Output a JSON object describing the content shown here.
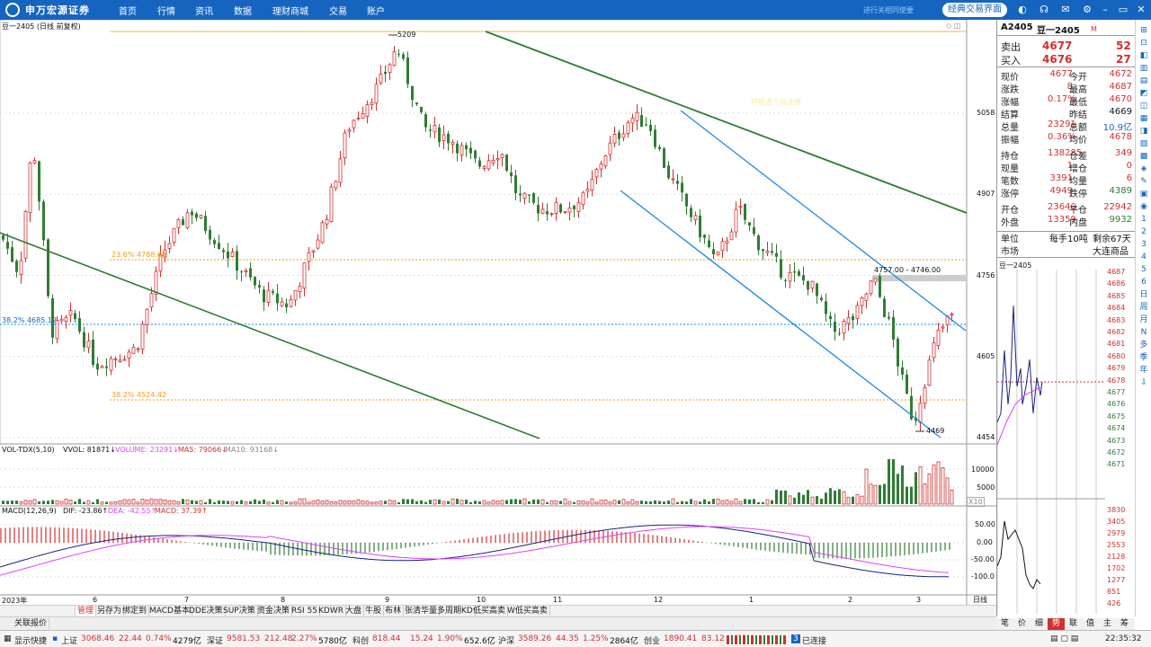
{
  "app": {
    "logo_text": "申万宏源证券",
    "nav": [
      "首页",
      "行情",
      "资讯",
      "数据",
      "理财商城",
      "交易",
      "账户"
    ],
    "faint_text": "进行关相同使要",
    "classic_btn": "经典交易界面"
  },
  "chart": {
    "symbol_title": "豆一2405 (日线 前复权)",
    "price_axis": [
      "5058",
      "4907",
      "4756",
      "4605",
      "4454"
    ],
    "fib_labels": [
      "23.6% 4788.68",
      "38.2% 4685.12",
      "38.2% 4524.42"
    ],
    "peak_label": "5209",
    "low_label": "4469",
    "range_label": "4757.00 - 4746.00",
    "faint_note": "可框选个段选择",
    "vol_header": {
      "name": "VOL-TDX(5,10)",
      "vvol": "VVOL: 81871↓",
      "volume": "VOLUME: 23291↓",
      "ma5": "MA5: 79066↓",
      "ma10": "MA10: 93168↓"
    },
    "vol_axis": [
      "10000",
      "5000",
      "X10"
    ],
    "macd_header": {
      "name": "MACD(12,26,9)",
      "dif": "DIF: -23.86↑",
      "dea": "DEA: -42.55↑",
      "macd": "MACD: 37.39↑"
    },
    "macd_axis": [
      "50.00",
      "0.00",
      "-50.00",
      "-100.0"
    ],
    "date_axis": [
      "2023年",
      "6",
      "7",
      "8",
      "9",
      "10",
      "11",
      "12",
      "1",
      "2",
      "3"
    ],
    "period_label": "日线",
    "zoom_minus": "−",
    "zoom_plus": "+"
  },
  "tabs": [
    "管理",
    "另存为",
    "绑定到",
    "MACD基本",
    "DDE决策",
    "SUP决策",
    "资金决策",
    "RSI 55",
    "KDWR",
    "大盘",
    "牛股",
    "布林",
    "张清华量",
    "多周期KD",
    "低买高卖",
    "W低买高卖"
  ],
  "quick_tab": "关联报价",
  "quote": {
    "code": "A2405",
    "name": "豆一2405",
    "flag": "M",
    "sell": {
      "label": "卖出",
      "price": "4677",
      "vol": "52"
    },
    "buy": {
      "label": "买入",
      "price": "4676",
      "vol": "27"
    },
    "rows": [
      [
        "现价",
        "4677",
        "今开",
        "4672"
      ],
      [
        "涨跌",
        "8",
        "最高",
        "4687"
      ],
      [
        "涨幅",
        "0.17%",
        "最低",
        "4670"
      ],
      [
        "结算",
        "",
        "昨结",
        "4669"
      ],
      [
        "总量",
        "23291",
        "总额",
        "10.9亿"
      ],
      [
        "振幅",
        "0.36%",
        "均价",
        "4678"
      ],
      [
        "持仓",
        "138285",
        "仓差",
        "349"
      ],
      [
        "现量",
        "1",
        "增仓",
        "0"
      ],
      [
        "笔数",
        "3391",
        "均量",
        "6"
      ],
      [
        "涨停",
        "4949",
        "跌停",
        "4389"
      ],
      [
        "开仓",
        "23640",
        "平仓",
        "22942"
      ],
      [
        "外盘",
        "13359",
        "内盘",
        "9932"
      ]
    ],
    "unit": {
      "label": "单位",
      "value": "每手10吨",
      "remain": "剩余67天"
    },
    "market": {
      "label": "市场",
      "value": "大连商品"
    },
    "mini_title": "豆一2405",
    "mini_prices": [
      "4687",
      "4686",
      "4685",
      "4684",
      "4683",
      "4682",
      "4681",
      "4680",
      "4679",
      "4678",
      "4677",
      "4676",
      "4675",
      "4674",
      "4673",
      "4672",
      "4671"
    ],
    "mini_vol": [
      "3830",
      "3405",
      "2979",
      "2553",
      "2128",
      "1702",
      "1277",
      "851",
      "426"
    ],
    "bottom_tabs": [
      "笔",
      "价",
      "细",
      "势",
      "联",
      "值",
      "主",
      "筹"
    ]
  },
  "status": {
    "quick": "显示快捷",
    "items": [
      {
        "name": "上证",
        "price": "3068.46",
        "chg": "22.44",
        "pct": "0.74%",
        "amt": "4279亿"
      },
      {
        "name": "深证",
        "price": "9581.53",
        "chg": "212.48",
        "pct": "2.27%",
        "amt": "5780亿"
      },
      {
        "name": "科创",
        "price": "818.44",
        "chg": "15.24",
        "pct": "1.90%",
        "amt": "652.6亿"
      },
      {
        "name": "沪深",
        "price": "3589.26",
        "chg": "44.35",
        "pct": "1.25%",
        "amt": "2864亿"
      },
      {
        "name": "创业",
        "price": "1890.41",
        "chg": "83.12",
        "pct": "4.60%",
        "amt": "2561亿"
      }
    ],
    "connected": "已连接",
    "time": "22:35:32"
  },
  "colors": {
    "up": "#d32f2f",
    "down": "#2e7d32",
    "accent": "#1565c0",
    "trend_blue": "#1e88e5"
  }
}
